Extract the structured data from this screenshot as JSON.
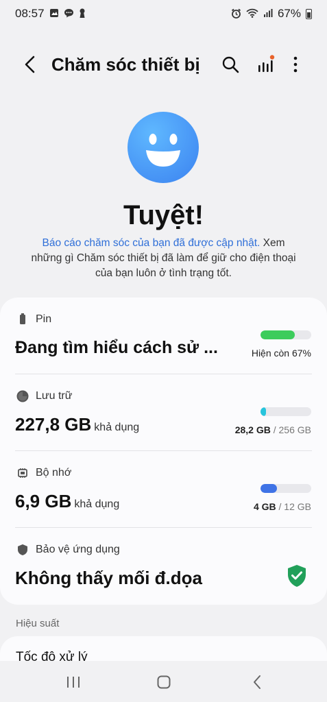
{
  "status_bar": {
    "time": "08:57",
    "battery_percent": "67%",
    "icons_left": [
      "gallery-icon",
      "chat-icon",
      "keyhole-icon"
    ],
    "icons_right": [
      "alarm-icon",
      "wifi-icon",
      "signal-icon",
      "battery-icon"
    ]
  },
  "app_bar": {
    "title": "Chăm sóc thiết bị",
    "actions": [
      "search-icon",
      "chart-icon",
      "more-icon"
    ],
    "badge_color": "#e8622a"
  },
  "hero": {
    "title": "Tuyệt!",
    "link_text": "Báo cáo chăm sóc của bạn đã được cập nhật.",
    "desc_text": " Xem những gì Chăm sóc thiết bị đã làm để giữ cho điện thoại của bạn luôn ở tình trạng tốt."
  },
  "sections": {
    "battery": {
      "label": "Pin",
      "value": "Đang tìm hiểu cách sử ...",
      "status": "Hiện còn 67%",
      "level": 0.67,
      "color": "#3ccc5c"
    },
    "storage": {
      "label": "Lưu trữ",
      "value": "227,8 GB",
      "unit": "khả dụng",
      "used": "28,2 GB",
      "separator": " / ",
      "total": "256 GB",
      "level": 0.11,
      "color": "#27c4dc"
    },
    "memory": {
      "label": "Bộ nhớ",
      "value": "6,9 GB",
      "unit": "khả dụng",
      "used": "4 GB",
      "separator": " / ",
      "total": "12 GB",
      "level": 0.33,
      "color": "#3f73e6"
    },
    "protection": {
      "label": "Bảo vệ ứng dụng",
      "value": "Không thấy mối đ.dọa",
      "color": "#21a05a"
    }
  },
  "performance": {
    "header": "Hiệu suất",
    "item": "Tốc độ xử lý"
  },
  "nav": [
    "recents-icon",
    "home-icon",
    "back-icon"
  ]
}
